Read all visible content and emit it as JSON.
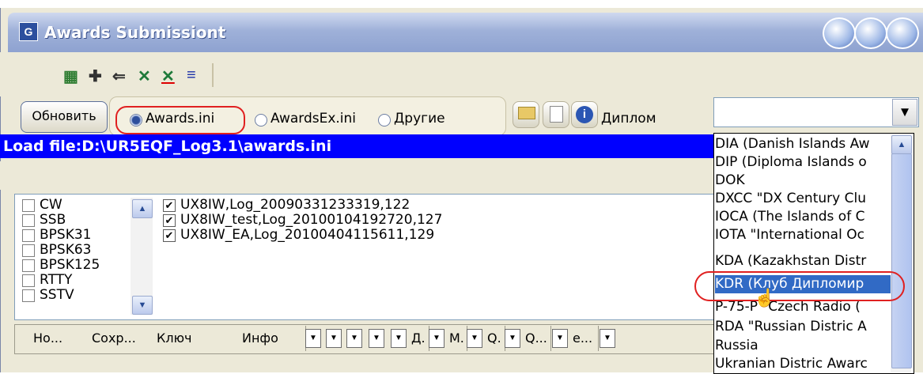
{
  "window": {
    "title": "Awards Submissiont"
  },
  "toolbar": {
    "icons": [
      "tree-icon",
      "add-icon",
      "arrow-icon",
      "excel-x-icon",
      "excel-x-underline-icon",
      "list-icon"
    ]
  },
  "controls": {
    "refresh_label": "Обновить",
    "radio_awards_ini": "Awards.ini",
    "radio_awardsex_ini": "AwardsEx.ini",
    "radio_other": "Другие",
    "diplom_label": "Диплом",
    "diplom_value": ""
  },
  "loadfile": "Load file:D:\\UR5EQF_Log3.1\\awards.ini",
  "modes": [
    "CW",
    "SSB",
    "BPSK31",
    "BPSK63",
    "BPSK125",
    "RTTY",
    "SSTV"
  ],
  "logs": [
    "UX8IW,Log_20090331233319,122",
    "UX8IW_test,Log_20100104192720,127",
    "UX8IW_EA,Log_20100404115611,129"
  ],
  "grid_headers": {
    "no": "Но...",
    "save": "Сохр...",
    "key": "Ключ",
    "info": "Инфо",
    "d": "Д.",
    "m": "М.",
    "q1": "Q.",
    "q2": "Q...",
    "e": "е..."
  },
  "dropdown_items": [
    "DIA (Danish Islands Aw",
    "DIP (Diploma Islands o",
    "DOK",
    "DXCC \"DX Century Clu",
    "IOCA (The Islands of C",
    "IOTA \"International Oc",
    "KDA (Kazakhstan Distr",
    "KDR (Клуб Дипломир",
    "P-75-P \"Czech Radio (",
    "RDA \"Russian Distric A",
    "Russia",
    "Ukranian Distric Awarc"
  ],
  "colors": {
    "selection": "#316ac5",
    "loadbar": "#0000ff",
    "highlight": "#e02020"
  }
}
